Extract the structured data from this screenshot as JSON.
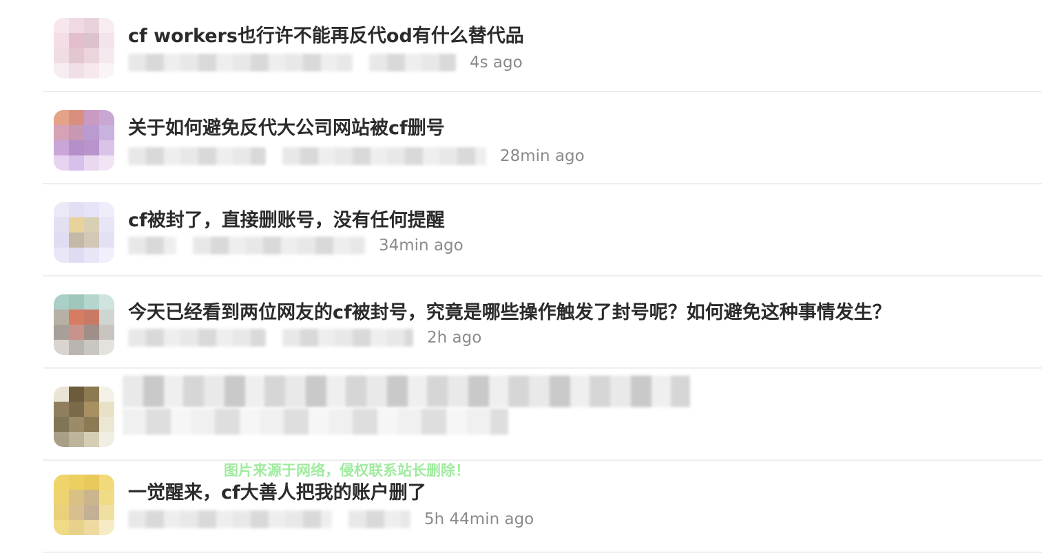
{
  "watermark": "图片来源于网络，侵权联系站长删除！",
  "colors": {
    "title_text": "#2b2b2b",
    "meta_text": "#8a8a8a",
    "divider": "#eeeeee",
    "watermark": "#8fe88f"
  },
  "topics": [
    {
      "title": "cf workers也行许不能再反代od有什么替代品",
      "time_ago": "4s ago",
      "avatar_palette": [
        "#f7e6ee",
        "#f1d9e3",
        "#ead2dc",
        "#f7edf1",
        "#f5dde7",
        "#e3bfcd",
        "#dcc2cc",
        "#f2e4ea",
        "#f0dde4",
        "#e4c6d1",
        "#ecd4dd",
        "#f4e9ee",
        "#f7ecf1",
        "#f1dee6",
        "#f6e8ed",
        "#fbf4f7"
      ]
    },
    {
      "title": "关于如何避免反代大公司网站被cf删号",
      "time_ago": "28min ago",
      "avatar_palette": [
        "#e4a287",
        "#d98f80",
        "#c99bc3",
        "#c8a7d4",
        "#d6a2b6",
        "#c797b4",
        "#b99bd0",
        "#c9b2e0",
        "#c8a6d8",
        "#b58fc9",
        "#b894cc",
        "#d9c4e7",
        "#e7d3f0",
        "#d7c0ea",
        "#ead8f1",
        "#f1e5f5"
      ]
    },
    {
      "title": "cf被封了，直接删账号，没有任何提醒",
      "time_ago": "34min ago",
      "avatar_palette": [
        "#ebe8f7",
        "#e2dff4",
        "#e6e3f8",
        "#efedf9",
        "#e3e0f4",
        "#e8d39c",
        "#d9cfb3",
        "#e7e5f7",
        "#e0ddf2",
        "#c4b8a6",
        "#d2c8b5",
        "#e4e1f5",
        "#e9e6f7",
        "#dedbf2",
        "#e8e5f7",
        "#f1effb"
      ]
    },
    {
      "title": "今天已经看到两位网友的cf被封号，究竟是哪些操作触发了封号呢？如何避免这种事情发生？",
      "time_ago": "2h ago",
      "avatar_palette": [
        "#a9cfc6",
        "#9ec6bd",
        "#b5d6cf",
        "#cfe4df",
        "#b7b1a5",
        "#d77c62",
        "#c87a66",
        "#cfd6cf",
        "#a89f98",
        "#c7938a",
        "#9f8f88",
        "#c9c4bf",
        "#d9d4cf",
        "#b9b5b0",
        "#cac6c2",
        "#e4e1de"
      ]
    },
    {
      "title": "",
      "time_ago": "",
      "avatar_palette": [
        "#e9e4d6",
        "#6d5c3b",
        "#8e7a52",
        "#f4f1e8",
        "#8f7f5e",
        "#7b6a4a",
        "#a99062",
        "#e7e1c6",
        "#807657",
        "#9c8b68",
        "#8c7a55",
        "#ece7d2",
        "#a89f86",
        "#bdb49c",
        "#d5cdb4",
        "#f1eee3"
      ]
    },
    {
      "title": "一觉醒来，cf大善人把我的账户删了",
      "time_ago": "5h 44min ago",
      "avatar_palette": [
        "#f0d36a",
        "#eccf61",
        "#e9c95a",
        "#f2d97a",
        "#efd271",
        "#d9c083",
        "#cbb58c",
        "#f1dc86",
        "#ead07a",
        "#d7bf8f",
        "#c4b095",
        "#efe0a2",
        "#f0da85",
        "#e8d18a",
        "#eed9a0",
        "#f6ebc5"
      ]
    }
  ]
}
